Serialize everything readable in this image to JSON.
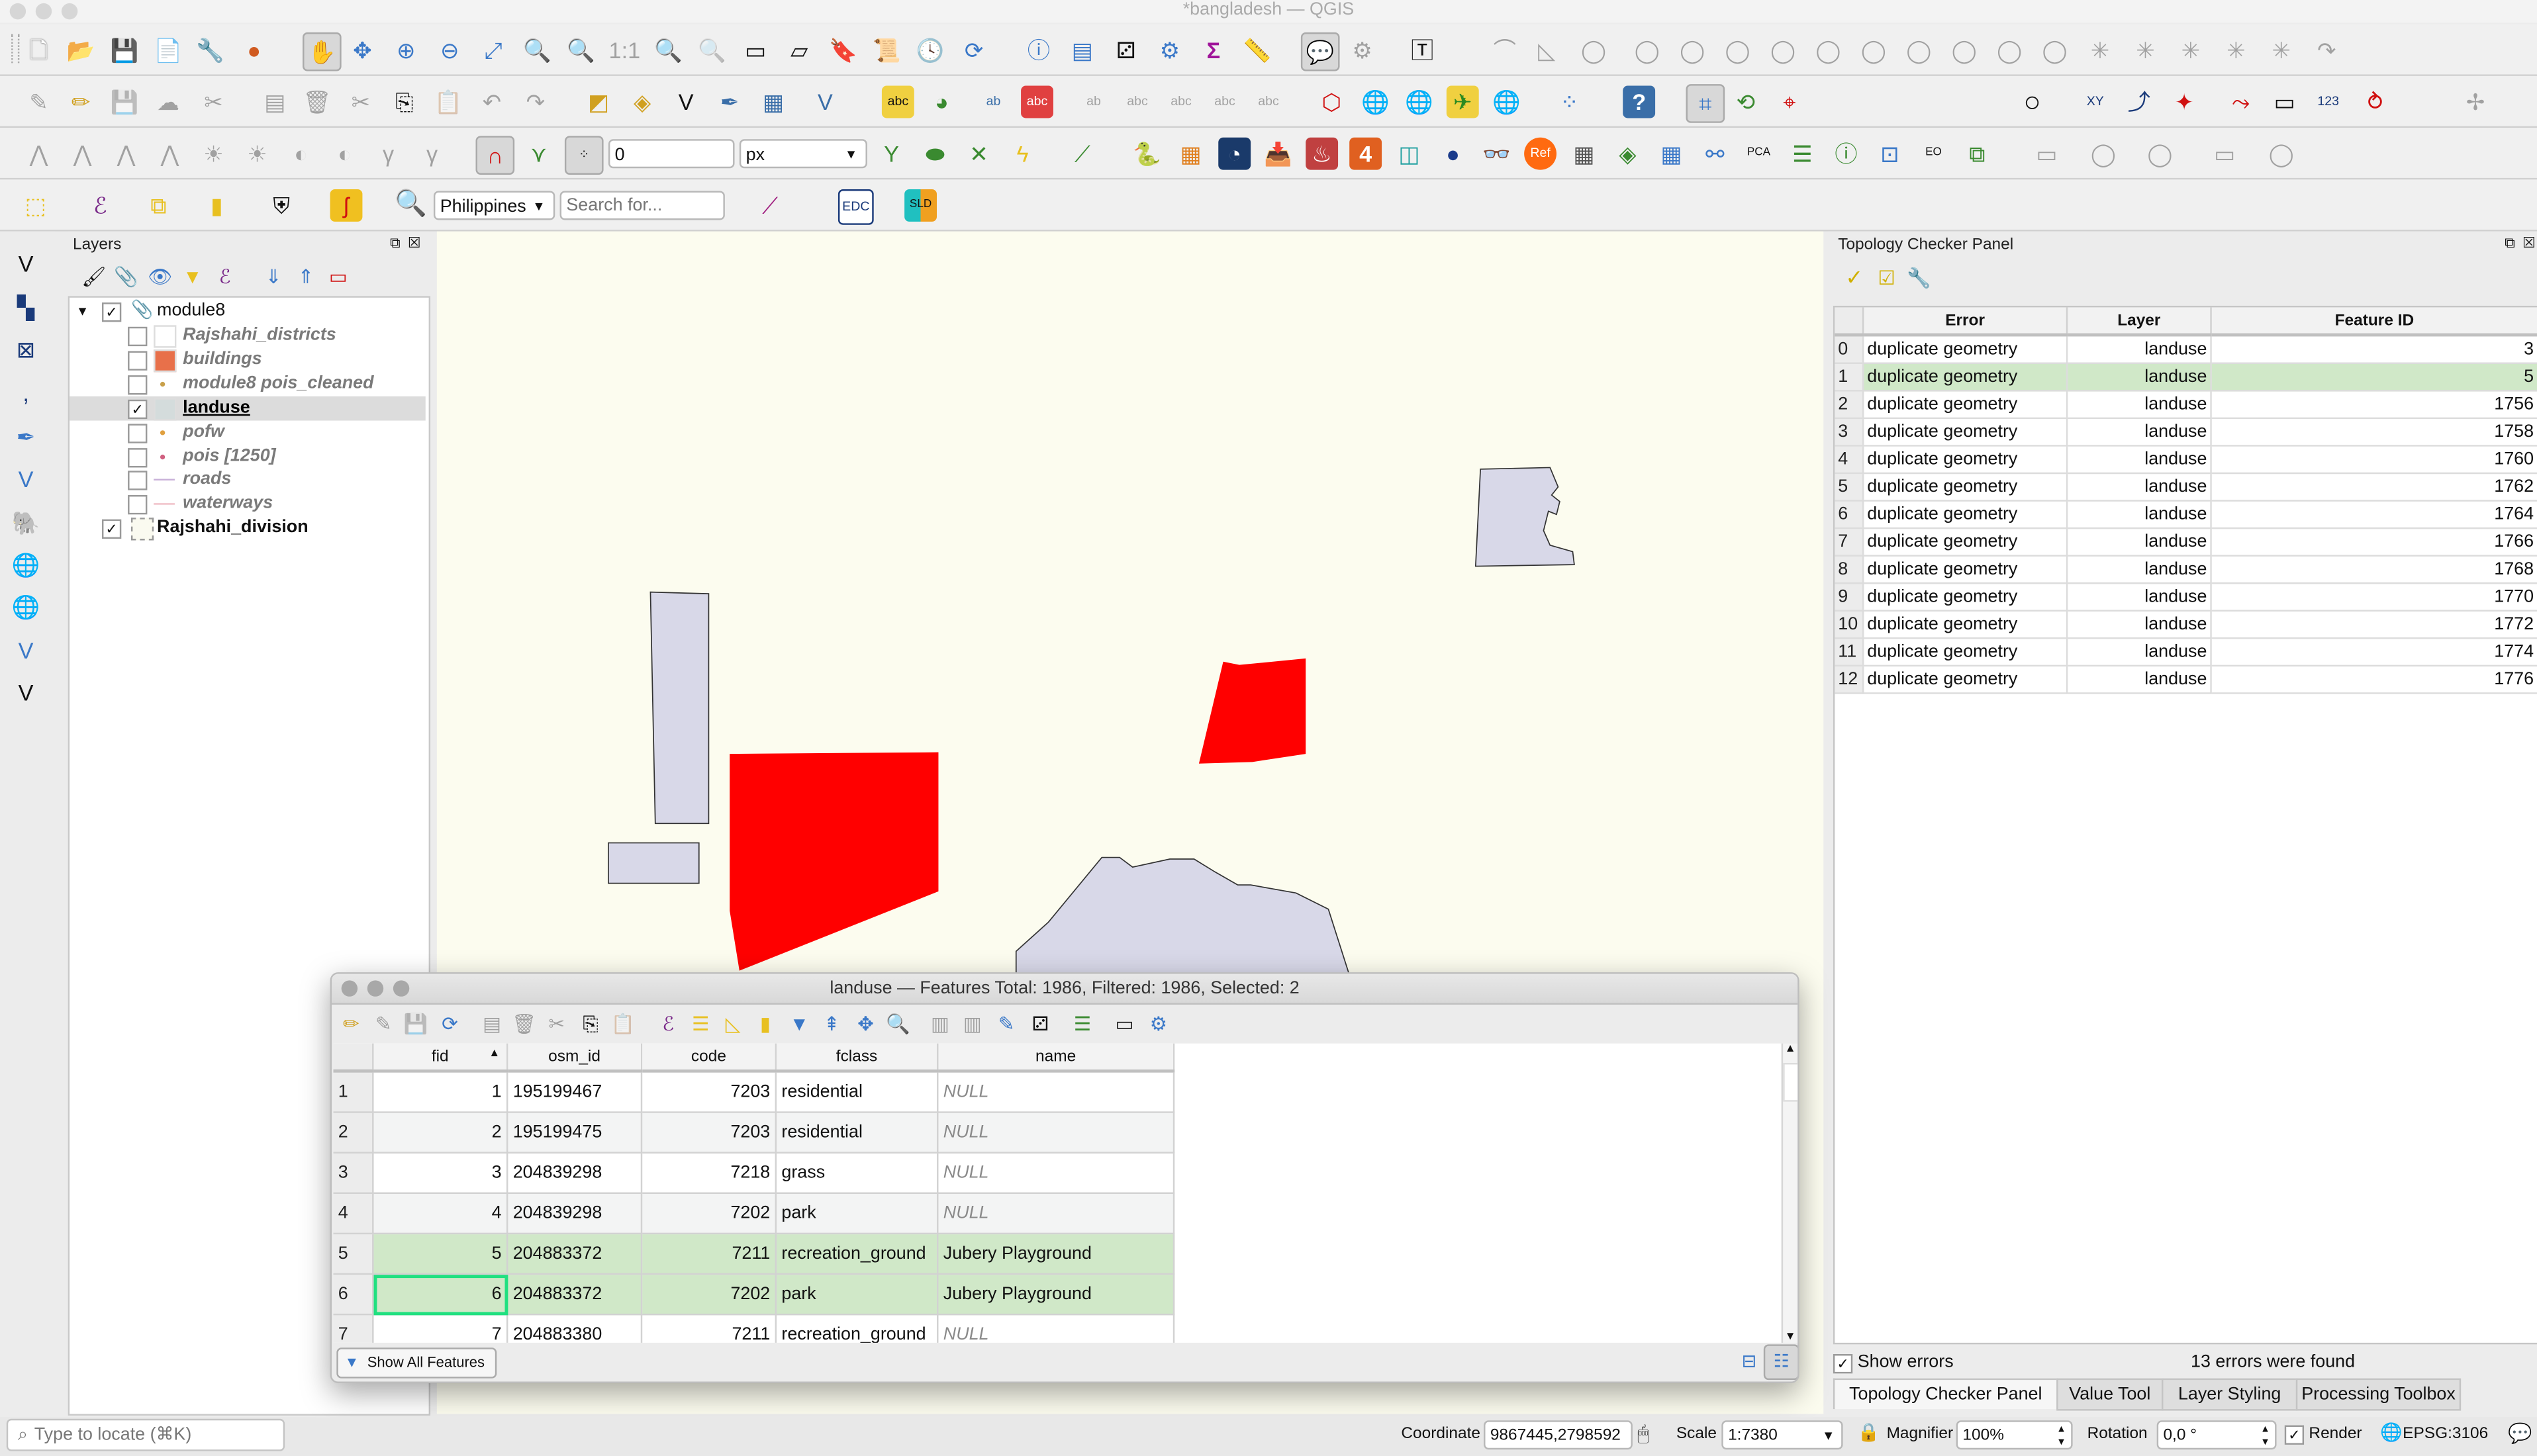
{
  "window": {
    "title": "*bangladesh — QGIS"
  },
  "toolbars": {
    "snapping_tolerance_value": "0",
    "snapping_units": "px",
    "locator_country": "Philippines",
    "search_placeholder": "Search for...",
    "edc_label": "EDC",
    "sld_label": "SLD"
  },
  "left_tools": [
    "add-vector-layer",
    "add-raster-layer",
    "add-mesh-layer",
    "add-delimited-text",
    "add-spatialite",
    "add-virtual-layer",
    "add-postgis",
    "add-wms",
    "add-wcs",
    "add-wfs",
    "add-vertex-layer"
  ],
  "layers_panel": {
    "title": "Layers",
    "group": {
      "name": "module8",
      "checked": true
    },
    "items": [
      {
        "name": "Rajshahi_districts",
        "checked": false,
        "symbol": "fill",
        "color": "#ffffff"
      },
      {
        "name": "buildings",
        "checked": false,
        "symbol": "fill",
        "color": "#e8704a"
      },
      {
        "name": "module8 pois_cleaned",
        "checked": false,
        "symbol": "point",
        "color": "#c8a04a"
      },
      {
        "name": "landuse",
        "checked": true,
        "symbol": "fill",
        "color": "#d4dcdc",
        "active": true
      },
      {
        "name": "pofw",
        "checked": false,
        "symbol": "point",
        "color": "#e0a040"
      },
      {
        "name": "pois [1250]",
        "checked": false,
        "symbol": "point",
        "color": "#d06080"
      },
      {
        "name": "roads",
        "checked": false,
        "symbol": "line",
        "color": "#c8b0d8"
      },
      {
        "name": "waterways",
        "checked": false,
        "symbol": "line",
        "color": "#f0c0c8"
      }
    ],
    "root_item": {
      "name": "Rajshahi_division",
      "checked": true,
      "color": "#fafaf0"
    }
  },
  "map": {
    "background": "#fcfcef",
    "feature_fill": "#d8d8e8",
    "selected_fill": "#ff0000"
  },
  "topology_panel": {
    "title": "Topology Checker Panel",
    "columns": [
      "Error",
      "Layer",
      "Feature ID"
    ],
    "rows": [
      {
        "idx": "0",
        "error": "duplicate geometry",
        "layer": "landuse",
        "fid": "3"
      },
      {
        "idx": "1",
        "error": "duplicate geometry",
        "layer": "landuse",
        "fid": "5",
        "selected": true
      },
      {
        "idx": "2",
        "error": "duplicate geometry",
        "layer": "landuse",
        "fid": "1756"
      },
      {
        "idx": "3",
        "error": "duplicate geometry",
        "layer": "landuse",
        "fid": "1758"
      },
      {
        "idx": "4",
        "error": "duplicate geometry",
        "layer": "landuse",
        "fid": "1760"
      },
      {
        "idx": "5",
        "error": "duplicate geometry",
        "layer": "landuse",
        "fid": "1762"
      },
      {
        "idx": "6",
        "error": "duplicate geometry",
        "layer": "landuse",
        "fid": "1764"
      },
      {
        "idx": "7",
        "error": "duplicate geometry",
        "layer": "landuse",
        "fid": "1766"
      },
      {
        "idx": "8",
        "error": "duplicate geometry",
        "layer": "landuse",
        "fid": "1768"
      },
      {
        "idx": "9",
        "error": "duplicate geometry",
        "layer": "landuse",
        "fid": "1770"
      },
      {
        "idx": "10",
        "error": "duplicate geometry",
        "layer": "landuse",
        "fid": "1772"
      },
      {
        "idx": "11",
        "error": "duplicate geometry",
        "layer": "landuse",
        "fid": "1774"
      },
      {
        "idx": "12",
        "error": "duplicate geometry",
        "layer": "landuse",
        "fid": "1776"
      }
    ],
    "show_errors_label": "Show errors",
    "show_errors_checked": true,
    "status": "13 errors were found",
    "tabs": [
      "Topology Checker Panel",
      "Value Tool",
      "Layer Styling",
      "Processing Toolbox"
    ],
    "active_tab": 0
  },
  "attribute_table": {
    "title": "landuse — Features Total: 1986, Filtered: 1986, Selected: 2",
    "columns": [
      "fid",
      "osm_id",
      "code",
      "fclass",
      "name"
    ],
    "sort_column": "fid",
    "rows": [
      {
        "n": "1",
        "fid": "1",
        "osm_id": "195199467",
        "code": "7203",
        "fclass": "residential",
        "name": "NULL"
      },
      {
        "n": "2",
        "fid": "2",
        "osm_id": "195199475",
        "code": "7203",
        "fclass": "residential",
        "name": "NULL"
      },
      {
        "n": "3",
        "fid": "3",
        "osm_id": "204839298",
        "code": "7218",
        "fclass": "grass",
        "name": "NULL"
      },
      {
        "n": "4",
        "fid": "4",
        "osm_id": "204839298",
        "code": "7202",
        "fclass": "park",
        "name": "NULL"
      },
      {
        "n": "5",
        "fid": "5",
        "osm_id": "204883372",
        "code": "7211",
        "fclass": "recreation_ground",
        "name": "Jubery Playground",
        "selected": true
      },
      {
        "n": "6",
        "fid": "6",
        "osm_id": "204883372",
        "code": "7202",
        "fclass": "park",
        "name": "Jubery Playground",
        "selected": true,
        "focused": true
      },
      {
        "n": "7",
        "fid": "7",
        "osm_id": "204883380",
        "code": "7211",
        "fclass": "recreation_ground",
        "name": "NULL"
      }
    ],
    "filter_button": "Show All Features"
  },
  "statusbar": {
    "locator_placeholder": "Type to locate (⌘K)",
    "coordinate_label": "Coordinate",
    "coordinate_value": "9867445,2798592",
    "scale_label": "Scale",
    "scale_value": "1:7380",
    "magnifier_label": "Magnifier",
    "magnifier_value": "100%",
    "rotation_label": "Rotation",
    "rotation_value": "0,0 °",
    "render_label": "Render",
    "render_checked": true,
    "crs": "EPSG:3106"
  }
}
